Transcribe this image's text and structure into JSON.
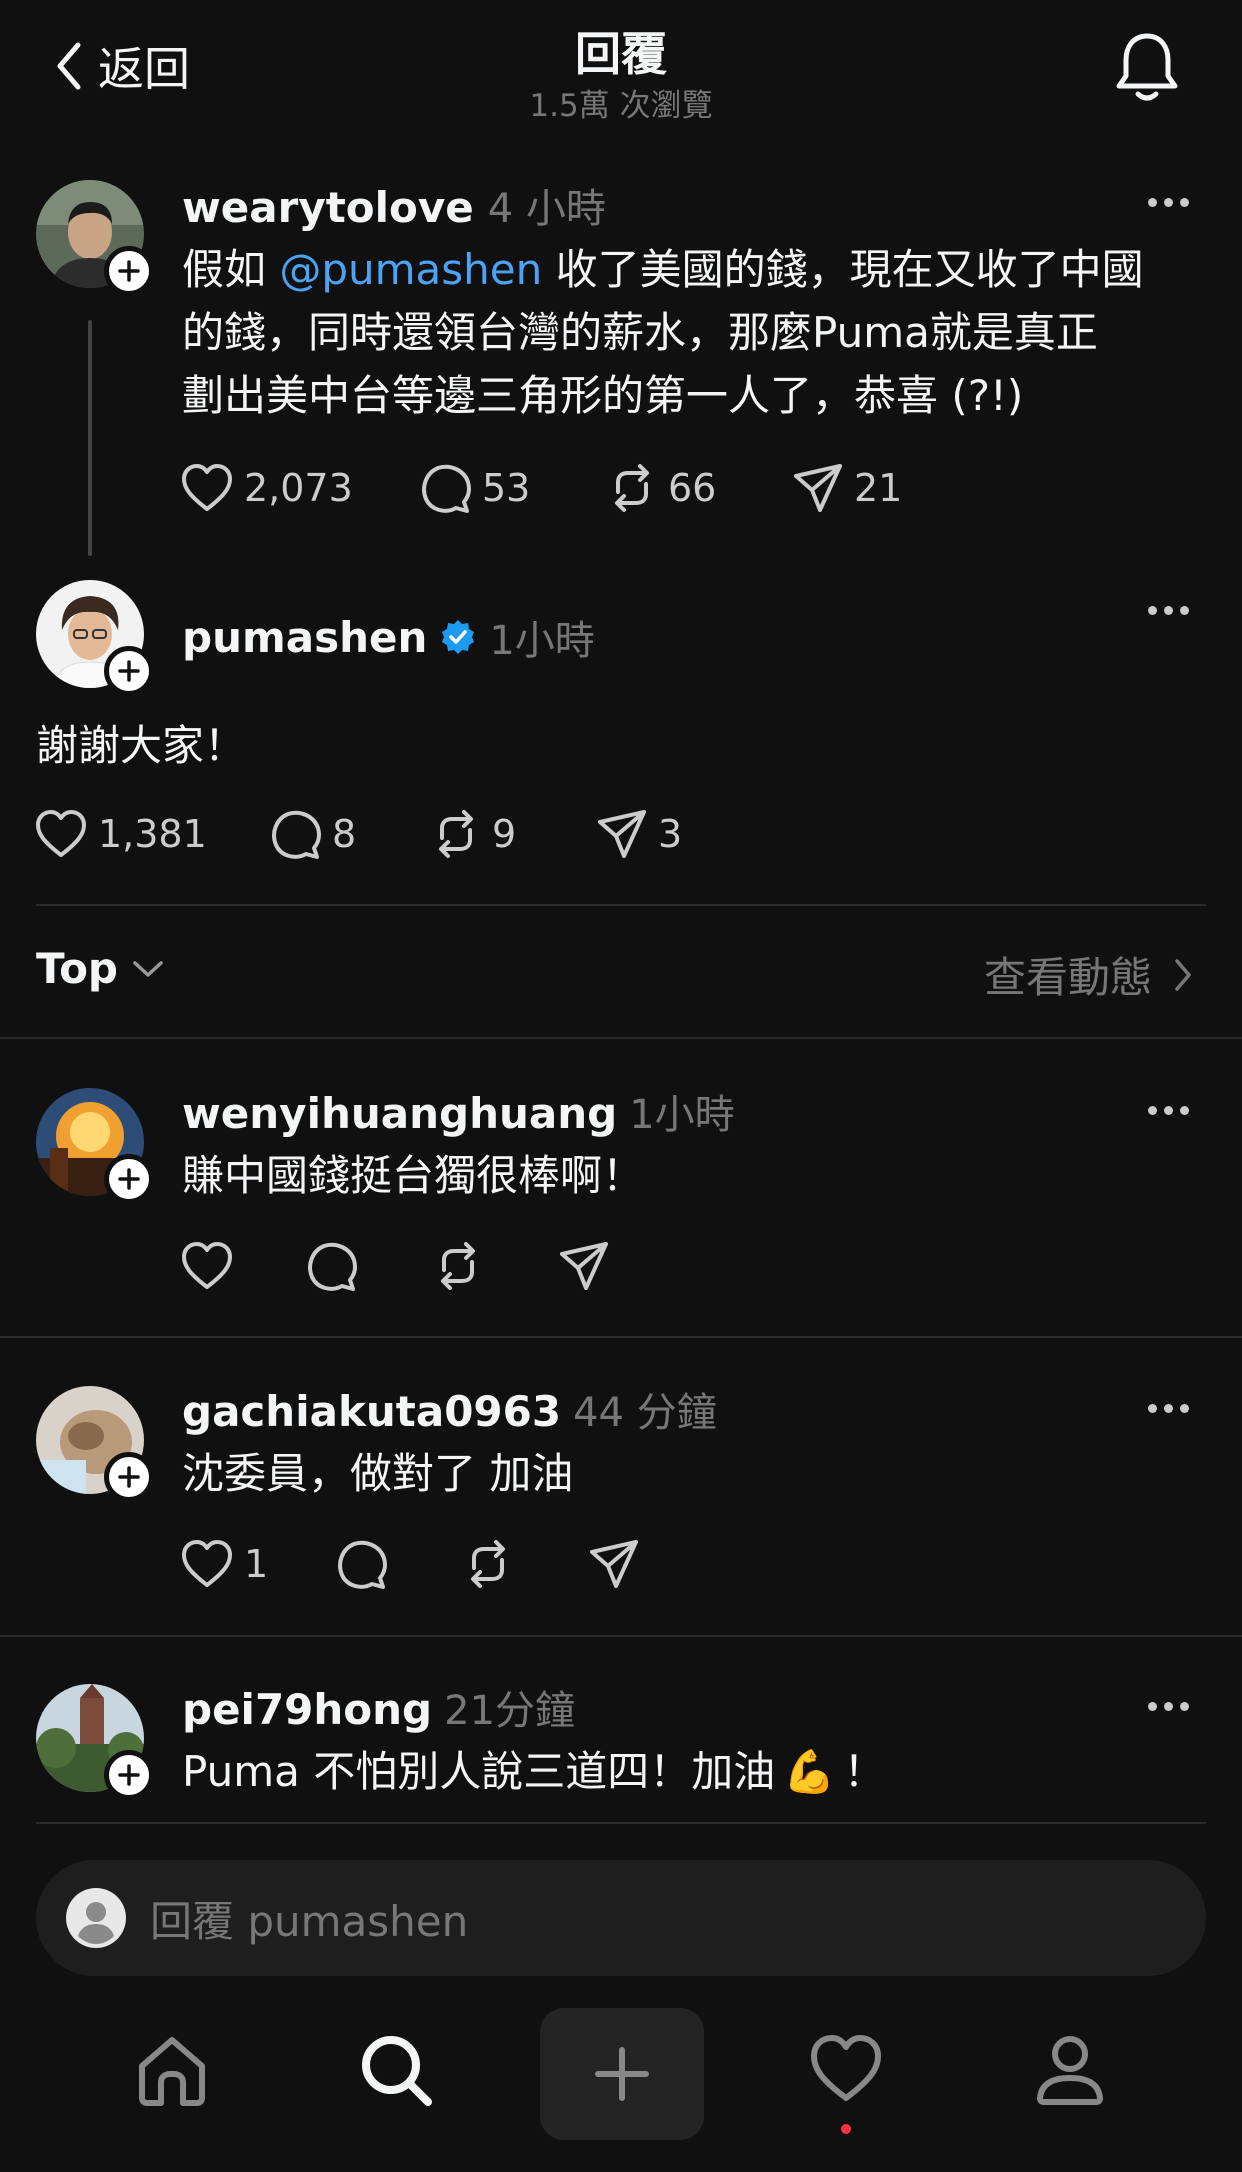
{
  "header": {
    "back_label": "返回",
    "title": "回覆",
    "views": "1.5萬 次瀏覽"
  },
  "original_post": {
    "username": "wearytolove",
    "time": "4 小時",
    "text_prefix": "假如 ",
    "mention": "@pumashen",
    "text_line1_rest": " 收了美國的錢，現在又收了中國",
    "text_line2": "的錢，同時還領台灣的薪水，那麼Puma就是真正",
    "text_line3": "劃出美中台等邊三角形的第一人了，恭喜 (?!)",
    "likes": "2,073",
    "comments": "53",
    "reposts": "66",
    "shares": "21"
  },
  "reply_post": {
    "username": "pumashen",
    "time": "1小時",
    "text": "謝謝大家！",
    "likes": "1,381",
    "comments": "8",
    "reposts": "9",
    "shares": "3"
  },
  "sort_bar": {
    "sort_label": "Top",
    "activity_label": "查看動態"
  },
  "comments": [
    {
      "username": "wenyihuanghuang",
      "time": "1小時",
      "text": "賺中國錢挺台獨很棒啊！",
      "likes": ""
    },
    {
      "username": "gachiakuta0963",
      "time": "44 分鐘",
      "text": "沈委員，做對了 加油",
      "likes": "1"
    },
    {
      "username": "pei79hong",
      "time": "21分鐘",
      "text_before": "Puma 不怕別人說三道四！加油",
      "emoji": "💪",
      "text_after": "！"
    }
  ],
  "reply_input": {
    "placeholder": "回覆 pumashen"
  },
  "colors": {
    "background": "#101010",
    "accent_blue": "#4ba3f5",
    "verified": "#1d9bf0",
    "notification_dot": "#ff3040"
  },
  "icons": [
    "chevron-left-icon",
    "bell-icon",
    "heart-icon",
    "comment-icon",
    "repost-icon",
    "share-icon",
    "verified-icon",
    "chevron-down-icon",
    "chevron-right-icon",
    "home-icon",
    "search-icon",
    "plus-icon",
    "profile-icon"
  ]
}
